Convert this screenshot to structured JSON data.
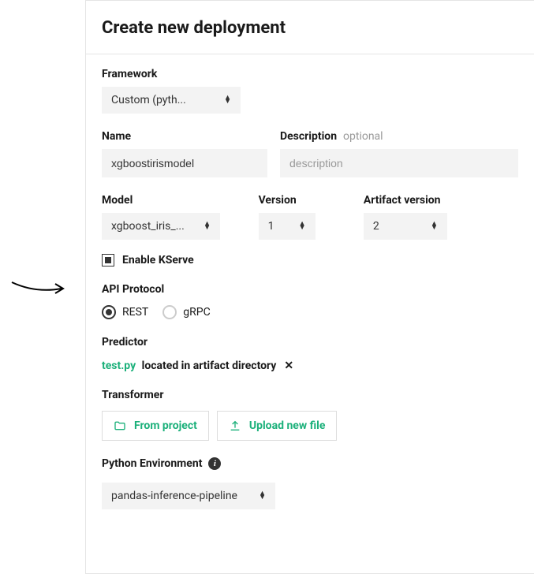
{
  "header": {
    "title": "Create new deployment"
  },
  "framework": {
    "label": "Framework",
    "selected": "Custom (pyth..."
  },
  "name": {
    "label": "Name",
    "value": "xgboostirismodel"
  },
  "description": {
    "label": "Description",
    "optional": "optional",
    "placeholder": "description",
    "value": ""
  },
  "model": {
    "label": "Model",
    "selected": "xgboost_iris_..."
  },
  "version": {
    "label": "Version",
    "selected": "1"
  },
  "artifact_version": {
    "label": "Artifact version",
    "selected": "2"
  },
  "kserve": {
    "label": "Enable KServe",
    "checked": true
  },
  "api_protocol": {
    "label": "API Protocol",
    "options": {
      "rest": "REST",
      "grpc": "gRPC"
    },
    "selected": "rest"
  },
  "predictor": {
    "label": "Predictor",
    "file": "test.py",
    "location_text": "located in artifact directory"
  },
  "transformer": {
    "label": "Transformer",
    "from_project": "From project",
    "upload": "Upload new file"
  },
  "python_env": {
    "label": "Python Environment",
    "selected": "pandas-inference-pipeline"
  }
}
